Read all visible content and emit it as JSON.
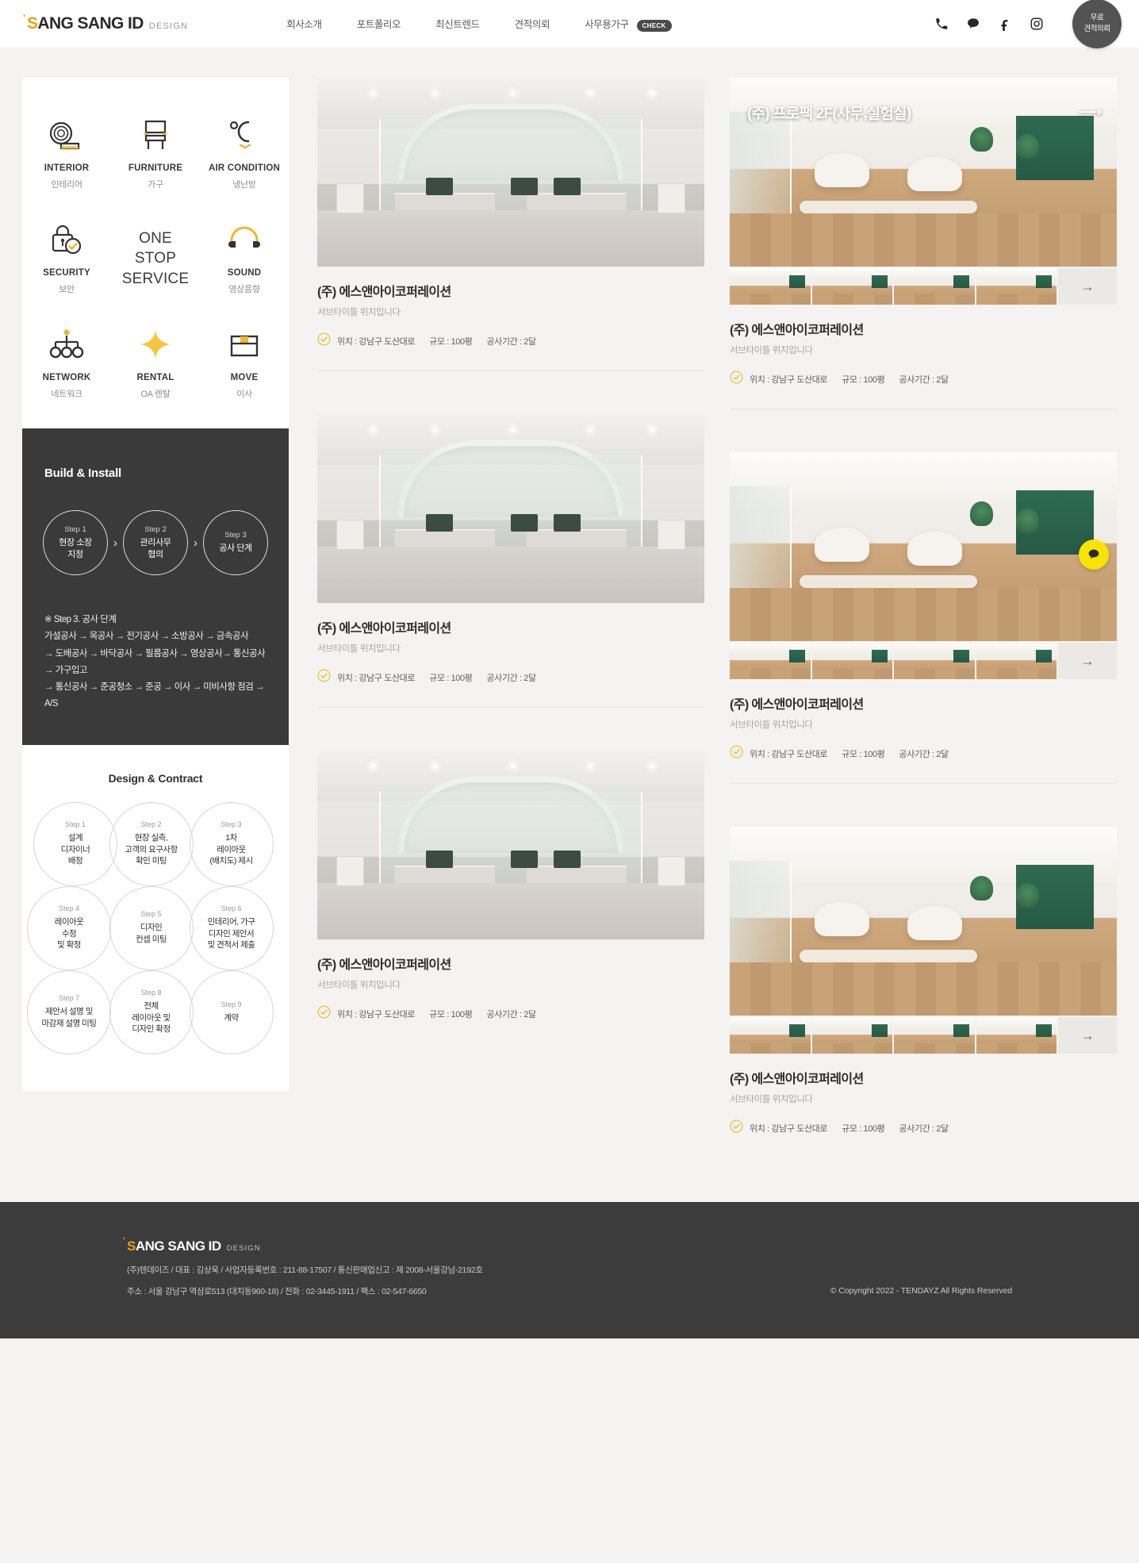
{
  "header": {
    "logo": {
      "tick": "'",
      "highlight": "S",
      "rest": "ANG SANG ID",
      "sub": "DESIGN"
    },
    "nav": [
      {
        "label": "회사소개"
      },
      {
        "label": "포트폴리오"
      },
      {
        "label": "최신트렌드"
      },
      {
        "label": "견적의뢰"
      },
      {
        "label": "사무용가구",
        "badge": "CHECK"
      }
    ],
    "icons": [
      "phone-icon",
      "chat-icon",
      "facebook-icon",
      "instagram-icon"
    ],
    "quote_button": {
      "line1": "무료",
      "line2": "견적의뢰"
    }
  },
  "sidebar": {
    "services": [
      {
        "en": "INTERIOR",
        "ko": "인테리어",
        "icon": "tape-measure-icon"
      },
      {
        "en": "FURNITURE",
        "ko": "가구",
        "icon": "chair-icon"
      },
      {
        "en": "AIR CONDITION",
        "ko": "냉난방",
        "icon": "temperature-icon"
      },
      {
        "en": "SECURITY",
        "ko": "보안",
        "icon": "lock-check-icon"
      },
      {
        "en": "ONE STOP SERVICE",
        "ko": "",
        "icon": "center-text"
      },
      {
        "en": "SOUND",
        "ko": "영상음향",
        "icon": "headphone-icon"
      },
      {
        "en": "NETWORK",
        "ko": "네트워크",
        "icon": "network-icon"
      },
      {
        "en": "RENTAL",
        "ko": "OA 렌탈",
        "icon": "sparkle-icon"
      },
      {
        "en": "MOVE",
        "ko": "이사",
        "icon": "box-icon"
      }
    ],
    "one_stop": {
      "l1": "ONE",
      "l2": "STOP",
      "l3": "SERVICE"
    },
    "build": {
      "title": "Build & Install",
      "steps": [
        {
          "n": "Step 1",
          "t1": "현장 소장",
          "t2": "지정"
        },
        {
          "n": "Step 2",
          "t1": "관리사무",
          "t2": "협의"
        },
        {
          "n": "Step 3",
          "t1": "공사 단계",
          "t2": ""
        }
      ],
      "arrow": "›",
      "note": [
        "※ Step 3. 공사 단계",
        "가설공사 → 목공사 → 전기공사 → 소방공사 → 금속공사",
        "→ 도배공사 → 바닥공사 → 필름공사 → 영상공사→ 통신공사 → 가구입고",
        "→ 통신공사 → 준공청소 → 준공 → 이사 → 미비사항 점검 → A/S"
      ]
    },
    "design": {
      "title": "Design & Contract",
      "steps": [
        {
          "n": "Step 1",
          "lines": [
            "설계",
            "디자이너",
            "배정"
          ]
        },
        {
          "n": "Step 2",
          "lines": [
            "현장 실측,",
            "고객의 요구사항",
            "확인 미팅"
          ]
        },
        {
          "n": "Step 3",
          "lines": [
            "1차",
            "레이아웃",
            "(배치도) 제시"
          ]
        },
        {
          "n": "Step 4",
          "lines": [
            "레이아웃",
            "수정",
            "및 확정"
          ]
        },
        {
          "n": "Step 5",
          "lines": [
            "디자인",
            "컨셉 미팅"
          ]
        },
        {
          "n": "Step 6",
          "lines": [
            "인테리어, 가구",
            "디자인 제안서",
            "및 견적서 제출"
          ]
        },
        {
          "n": "Step 7",
          "lines": [
            "제안서 설명 및",
            "마감재 설명 미팅"
          ]
        },
        {
          "n": "Step 8",
          "lines": [
            "전체",
            "레이아웃 및",
            "디자인 확정"
          ]
        },
        {
          "n": "Step 9",
          "lines": [
            "계약"
          ]
        }
      ]
    }
  },
  "portfolio": {
    "left": [
      {
        "title": "(주) 에스앤아이코퍼레이션",
        "subtitle": "서브타이틀 위치입니다",
        "location": "위치 : 강남구 도산대로",
        "size": "규모 : 100평",
        "duration": "공사기간 : 2달",
        "photo": "office"
      },
      {
        "title": "(주) 에스앤아이코퍼레이션",
        "subtitle": "서브타이틀 위치입니다",
        "location": "위치 : 강남구 도산대로",
        "size": "규모 : 100평",
        "duration": "공사기간 : 2달",
        "photo": "office"
      },
      {
        "title": "(주) 에스앤아이코퍼레이션",
        "subtitle": "서브타이틀 위치입니다",
        "location": "위치 : 강남구 도산대로",
        "size": "규모 : 100평",
        "duration": "공사기간 : 2달",
        "photo": "office"
      }
    ],
    "right": [
      {
        "hero_label": "(주) 프로팩 2F(사무,실험실)",
        "title": "(주) 에스앤아이코퍼레이션",
        "subtitle": "서브타이틀 위치입니다",
        "location": "위치 : 강남구 도산대로",
        "size": "규모 : 100평",
        "duration": "공사기간 : 2달",
        "photo": "lounge",
        "thumb_count": 4,
        "next_arrow": "→"
      },
      {
        "hero_label": "",
        "title": "(주) 에스앤아이코퍼레이션",
        "subtitle": "서브타이틀 위치입니다",
        "location": "위치 : 강남구 도산대로",
        "size": "규모 : 100평",
        "duration": "공사기간 : 2달",
        "photo": "lounge",
        "thumb_count": 4,
        "next_arrow": "→"
      },
      {
        "hero_label": "",
        "title": "(주) 에스앤아이코퍼레이션",
        "subtitle": "서브타이틀 위치입니다",
        "location": "위치 : 강남구 도산대로",
        "size": "규모 : 100평",
        "duration": "공사기간 : 2달",
        "photo": "lounge",
        "thumb_count": 4,
        "next_arrow": "→"
      }
    ]
  },
  "footer": {
    "logo": {
      "tick": "'",
      "highlight": "S",
      "rest": "ANG SANG ID",
      "sub": "DESIGN"
    },
    "line1": "(주)텐데이즈 / 대표 : 김상욱 / 사업자등록번호 : 211-88-17507 / 통신판매업신고 : 제 2008-서울강남-2192호",
    "line2": "주소 : 서울 강남구 역삼로513 (대치동960-18) / 전화 : 02-3445-1911 / 팩스 : 02-547-6650",
    "copyright": "© Copyright 2022 - TENDAYZ All Rights Reserved"
  },
  "colors": {
    "accent": "#e8a317",
    "dark": "#3a3a3a",
    "chat": "#fbe300"
  }
}
